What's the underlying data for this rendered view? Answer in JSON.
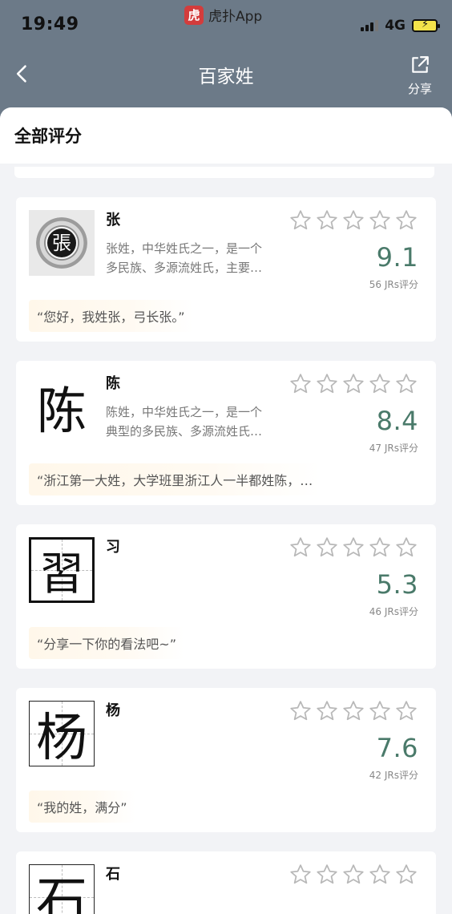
{
  "status_bar": {
    "time": "19:49",
    "app_badge_icon": "虎",
    "app_name": "虎扑App",
    "network": "4G"
  },
  "nav": {
    "title": "百家姓",
    "share_label": "分享"
  },
  "section": {
    "title": "全部评分"
  },
  "items": [
    {
      "name": "张",
      "thumb_char": "張",
      "desc_line1": "张姓，中华姓氏之一，是一个",
      "desc_line2": "多民族、多源流姓氏，主要…",
      "score": "9.1",
      "votes": "56 JRs评分",
      "comment": "“您好，我姓张，弓长张。”"
    },
    {
      "name": "陈",
      "thumb_char": "陈",
      "desc_line1": "陈姓，中华姓氏之一，是一个",
      "desc_line2": "典型的多民族、多源流姓氏…",
      "score": "8.4",
      "votes": "47 JRs评分",
      "comment": "“浙江第一大姓，大学班里浙江人一半都姓陈，…"
    },
    {
      "name": "习",
      "thumb_char": "習",
      "score": "5.3",
      "votes": "46 JRs评分",
      "comment": "“分享一下你的看法吧~”"
    },
    {
      "name": "杨",
      "thumb_char": "杨",
      "score": "7.6",
      "votes": "42 JRs评分",
      "comment": "“我的姓，满分”"
    },
    {
      "name": "石",
      "thumb_char": "石"
    }
  ],
  "colors": {
    "header_bg": "#6c7a88",
    "score": "#4a7a6a",
    "sheet_bg": "#f2f3f6"
  },
  "icons": {
    "back": "chevron-left-icon",
    "share": "share-icon",
    "star": "star-outline-icon"
  }
}
